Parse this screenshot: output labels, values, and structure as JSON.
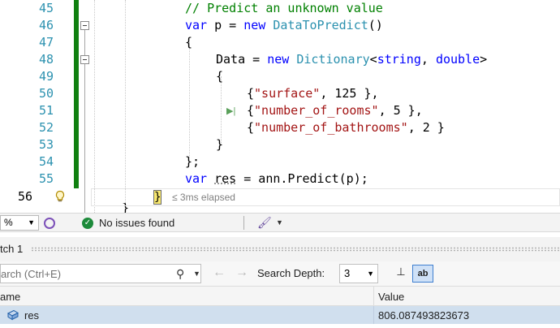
{
  "editor": {
    "line_numbers": [
      "45",
      "46",
      "47",
      "48",
      "49",
      "50",
      "51",
      "52",
      "53",
      "54",
      "55",
      "56"
    ],
    "code": {
      "l45_comment": "// Predict an unknown value",
      "l46_var": "var",
      "l46_name": " p = ",
      "l46_new": "new",
      "l46_type": "DataToPredict",
      "l46_end": "()",
      "l47": "{",
      "l48_data": "Data = ",
      "l48_new": "new",
      "l48_type": "Dictionary",
      "l48_lt": "<",
      "l48_string": "string",
      "l48_comma": ", ",
      "l48_double": "double",
      "l48_gt": ">",
      "l49": "{",
      "l50_open": "{",
      "l50_key": "\"surface\"",
      "l50_rest": ", 125 },",
      "l51_open": "{",
      "l51_key": "\"number_of_rooms\"",
      "l51_rest": ", 5 },",
      "l52_open": "{",
      "l52_key": "\"number_of_bathrooms\"",
      "l52_rest": ", 2 }",
      "l53": "}",
      "l54": "};",
      "l55_var": "var",
      "l55_space": " ",
      "l55_res": "res",
      "l55_rest": " = ann.Predict(p);",
      "l56_brace": "}",
      "l57_partial": "}"
    },
    "elapsed_text": "≤ 3ms elapsed"
  },
  "status_bar": {
    "zoom": "%",
    "issues": "No issues found"
  },
  "watch": {
    "title": "tch 1",
    "search_placeholder": "arch (Ctrl+E)",
    "search_depth_label": "Search Depth:",
    "search_depth_value": "3",
    "ab_label": "ab",
    "columns": {
      "name": "ame",
      "value": "Value"
    },
    "rows": [
      {
        "name": "res",
        "value": "806.087493823673"
      }
    ]
  },
  "colors": {
    "keyword": "#0000ff",
    "type": "#2b91af",
    "string": "#a31515",
    "comment": "#008000",
    "change_bar": "#108010",
    "selected_row": "#d0dfee"
  }
}
